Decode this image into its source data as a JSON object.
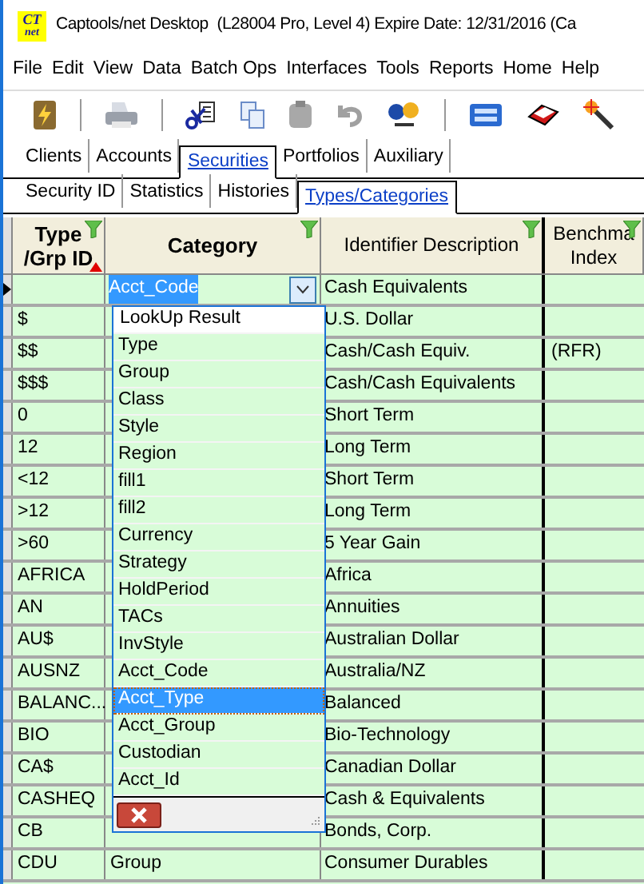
{
  "window": {
    "title": "Captools/net Desktop  (L28004 Pro, Level 4) Expire Date: 12/31/2016 (Ca",
    "logo": [
      "CT",
      "net"
    ]
  },
  "menu": [
    "File",
    "Edit",
    "View",
    "Data",
    "Batch Ops",
    "Interfaces",
    "Tools",
    "Reports",
    "Home",
    "Help"
  ],
  "tabs": [
    {
      "label": "Clients",
      "selected": false
    },
    {
      "label": "Accounts",
      "selected": false
    },
    {
      "label": "Securities",
      "selected": true
    },
    {
      "label": "Portfolios",
      "selected": false
    },
    {
      "label": "Auxiliary",
      "selected": false
    }
  ],
  "subtabs": [
    {
      "label": "Security ID",
      "selected": false
    },
    {
      "label": "Statistics",
      "selected": false
    },
    {
      "label": "Histories",
      "selected": false
    },
    {
      "label": "Types/Categories",
      "selected": true
    }
  ],
  "grid": {
    "columns": [
      {
        "lines": [
          "Type",
          "/Grp ID"
        ],
        "filter": true,
        "sorted": true
      },
      {
        "lines": [
          "Category"
        ],
        "filter": true,
        "sorted": false
      },
      {
        "lines": [
          "Identifier Description"
        ],
        "filter": true,
        "sorted": false
      },
      {
        "lines": [
          "Benchma",
          "Index"
        ],
        "filter": true,
        "sorted": false
      }
    ],
    "rows": [
      {
        "type": "",
        "category": "Acct_Code",
        "description": "Cash Equivalents",
        "current": true
      },
      {
        "type": "$",
        "description": "U.S. Dollar",
        "current": false
      },
      {
        "type": "$$",
        "description": "Cash/Cash Equiv.",
        "benchmark": "(RFR)",
        "current": false
      },
      {
        "type": "$$$",
        "description": "Cash/Cash Equivalents",
        "current": false
      },
      {
        "type": "0",
        "description": "Short Term",
        "current": false
      },
      {
        "type": "12",
        "description": "Long Term",
        "current": false
      },
      {
        "type": "<12",
        "description": "Short Term",
        "current": false
      },
      {
        "type": ">12",
        "description": "Long Term",
        "current": false
      },
      {
        "type": ">60",
        "description": "5 Year Gain",
        "current": false
      },
      {
        "type": "AFRICA",
        "description": "Africa",
        "current": false
      },
      {
        "type": "AN",
        "description": "Annuities",
        "current": false
      },
      {
        "type": "AU$",
        "description": "Australian Dollar",
        "current": false
      },
      {
        "type": "AUSNZ",
        "description": "Australia/NZ",
        "current": false
      },
      {
        "type": "BALANC...",
        "description": "Balanced",
        "current": false
      },
      {
        "type": "BIO",
        "description": "Bio-Technology",
        "current": false
      },
      {
        "type": "CA$",
        "description": "Canadian Dollar",
        "current": false
      },
      {
        "type": "CASHEQ",
        "description": "Cash & Equivalents",
        "current": false
      },
      {
        "type": "CB",
        "description": "Bonds, Corp.",
        "current": false
      },
      {
        "type": "CDU",
        "category": "Group",
        "description": "Consumer Durables",
        "current": false
      }
    ]
  },
  "dropdown": {
    "items": [
      {
        "label": "LookUp Result",
        "kind": "header"
      },
      {
        "label": "Type",
        "kind": "option",
        "selected": false
      },
      {
        "label": "Group",
        "kind": "option",
        "selected": false
      },
      {
        "label": "Class",
        "kind": "option",
        "selected": false
      },
      {
        "label": "Style",
        "kind": "option",
        "selected": false
      },
      {
        "label": "Region",
        "kind": "option",
        "selected": false
      },
      {
        "label": "fill1",
        "kind": "option",
        "selected": false
      },
      {
        "label": "fill2",
        "kind": "option",
        "selected": false
      },
      {
        "label": "Currency",
        "kind": "option",
        "selected": false
      },
      {
        "label": "Strategy",
        "kind": "option",
        "selected": false
      },
      {
        "label": "HoldPeriod",
        "kind": "option",
        "selected": false
      },
      {
        "label": "TACs",
        "kind": "option",
        "selected": false
      },
      {
        "label": "InvStyle",
        "kind": "option",
        "selected": false
      },
      {
        "label": "Acct_Code",
        "kind": "option",
        "selected": false
      },
      {
        "label": "Acct_Type",
        "kind": "option",
        "selected": true
      },
      {
        "label": "Acct_Group",
        "kind": "option",
        "selected": false
      },
      {
        "label": "Custodian",
        "kind": "option",
        "selected": false
      },
      {
        "label": "Acct_Id",
        "kind": "option",
        "selected": false
      }
    ]
  }
}
